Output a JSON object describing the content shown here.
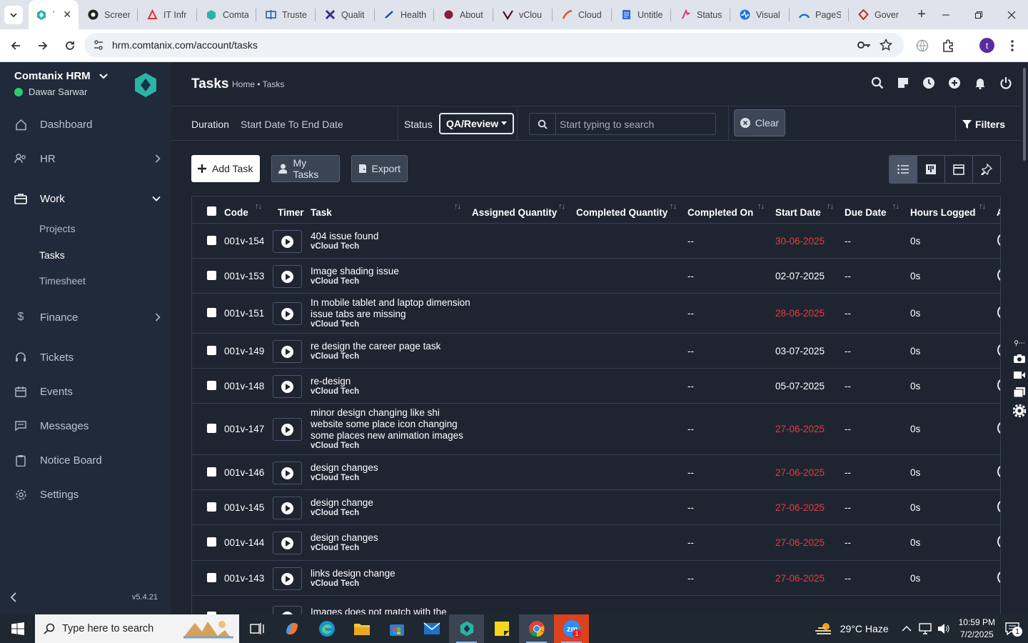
{
  "browser": {
    "tabs": [
      {
        "title": "Ta",
        "icon": "comtanix-icon",
        "active": true
      },
      {
        "title": "Screen",
        "icon": "screencast-icon"
      },
      {
        "title": "IT Infr",
        "icon": "gitlab-icon"
      },
      {
        "title": "Comta",
        "icon": "comtanix-icon"
      },
      {
        "title": "Truste",
        "icon": "trust-icon"
      },
      {
        "title": "Qualit",
        "icon": "x-icon"
      },
      {
        "title": "Health",
        "icon": "pen-icon"
      },
      {
        "title": "About",
        "icon": "about-icon"
      },
      {
        "title": "vClou",
        "icon": "vcloud-icon"
      },
      {
        "title": "Cloud",
        "icon": "cloud-icon"
      },
      {
        "title": "Untitle",
        "icon": "doc-icon"
      },
      {
        "title": "Status",
        "icon": "status-icon"
      },
      {
        "title": "Visual",
        "icon": "pulse-icon"
      },
      {
        "title": "PageS",
        "icon": "speed-icon"
      },
      {
        "title": "Gover",
        "icon": "gov-icon"
      }
    ],
    "url": "hrm.comtanix.com/account/tasks",
    "profile_initial": "t"
  },
  "sidebar": {
    "brand": "Comtanix HRM",
    "user": "Dawar Sarwar",
    "items": [
      {
        "label": "Dashboard",
        "icon": "home-icon"
      },
      {
        "label": "HR",
        "icon": "users-icon"
      },
      {
        "label": "Work",
        "icon": "briefcase-icon"
      },
      {
        "label": "Finance",
        "icon": "dollar-icon"
      },
      {
        "label": "Tickets",
        "icon": "headset-icon"
      },
      {
        "label": "Events",
        "icon": "calendar-icon"
      },
      {
        "label": "Messages",
        "icon": "message-icon"
      },
      {
        "label": "Notice Board",
        "icon": "clipboard-icon"
      },
      {
        "label": "Settings",
        "icon": "gear-icon"
      }
    ],
    "work_sub": [
      "Projects",
      "Tasks",
      "Timesheet"
    ],
    "version": "v5.4.21"
  },
  "page": {
    "title": "Tasks",
    "breadcrumb": "Home • Tasks"
  },
  "filters": {
    "duration_label": "Duration",
    "duration_value": "Start Date To End Date",
    "status_label": "Status",
    "status_value": "QA/Review",
    "search_placeholder": "Start typing to search",
    "clear_label": "Clear",
    "filters_label": "Filters"
  },
  "actions": {
    "add": "Add Task",
    "my": "My Tasks",
    "export": "Export"
  },
  "table": {
    "columns": [
      "Code",
      "Timer",
      "Task",
      "Assigned Quantity",
      "Completed Quantity",
      "Completed On",
      "Start Date",
      "Due Date",
      "Hours Logged",
      "A"
    ],
    "rows": [
      {
        "code": "001v-154",
        "task": "404 issue found",
        "project": "vCloud Tech",
        "completed_on": "--",
        "start": "30-06-2025",
        "overdue": true,
        "due": "--",
        "hours": "0s"
      },
      {
        "code": "001v-153",
        "task": "Image shading issue",
        "project": "vCloud Tech",
        "completed_on": "--",
        "start": "02-07-2025",
        "overdue": false,
        "due": "--",
        "hours": "0s"
      },
      {
        "code": "001v-151",
        "task": "In mobile tablet and laptop dimension issue tabs are missing",
        "project": "vCloud Tech",
        "completed_on": "--",
        "start": "28-06-2025",
        "overdue": true,
        "due": "--",
        "hours": "0s"
      },
      {
        "code": "001v-149",
        "task": "re design the career page task",
        "project": "vCloud Tech",
        "completed_on": "--",
        "start": "03-07-2025",
        "overdue": false,
        "due": "--",
        "hours": "0s"
      },
      {
        "code": "001v-148",
        "task": "re-design",
        "project": "vCloud Tech",
        "completed_on": "--",
        "start": "05-07-2025",
        "overdue": false,
        "due": "--",
        "hours": "0s"
      },
      {
        "code": "001v-147",
        "task": "minor design changing like shi website some place icon changing some places new animation images",
        "project": "vCloud Tech",
        "completed_on": "--",
        "start": "27-06-2025",
        "overdue": true,
        "due": "--",
        "hours": "0s"
      },
      {
        "code": "001v-146",
        "task": "design changes",
        "project": "vCloud Tech",
        "completed_on": "--",
        "start": "27-06-2025",
        "overdue": true,
        "due": "--",
        "hours": "0s"
      },
      {
        "code": "001v-145",
        "task": "design change",
        "project": "vCloud Tech",
        "completed_on": "--",
        "start": "27-06-2025",
        "overdue": true,
        "due": "--",
        "hours": "0s"
      },
      {
        "code": "001v-144",
        "task": "design changes",
        "project": "vCloud Tech",
        "completed_on": "--",
        "start": "27-06-2025",
        "overdue": true,
        "due": "--",
        "hours": "0s"
      },
      {
        "code": "001v-143",
        "task": "links design change",
        "project": "vCloud Tech",
        "completed_on": "--",
        "start": "27-06-2025",
        "overdue": true,
        "due": "--",
        "hours": "0s"
      },
      {
        "code": "",
        "task": "Images does not match with the",
        "project": "",
        "completed_on": "",
        "start": "",
        "overdue": false,
        "due": "",
        "hours": ""
      }
    ]
  },
  "taskbar": {
    "search_placeholder": "Type here to search",
    "weather": "29°C  Haze",
    "time": "10:59 PM",
    "date": "7/2/2025",
    "notif_count": "1",
    "zoom_badge": "1"
  },
  "colors": {
    "overdue": "#e53b3b",
    "sidebar_bg": "#202a3a",
    "main_bg": "#1e2531",
    "online": "#2ecc71"
  }
}
